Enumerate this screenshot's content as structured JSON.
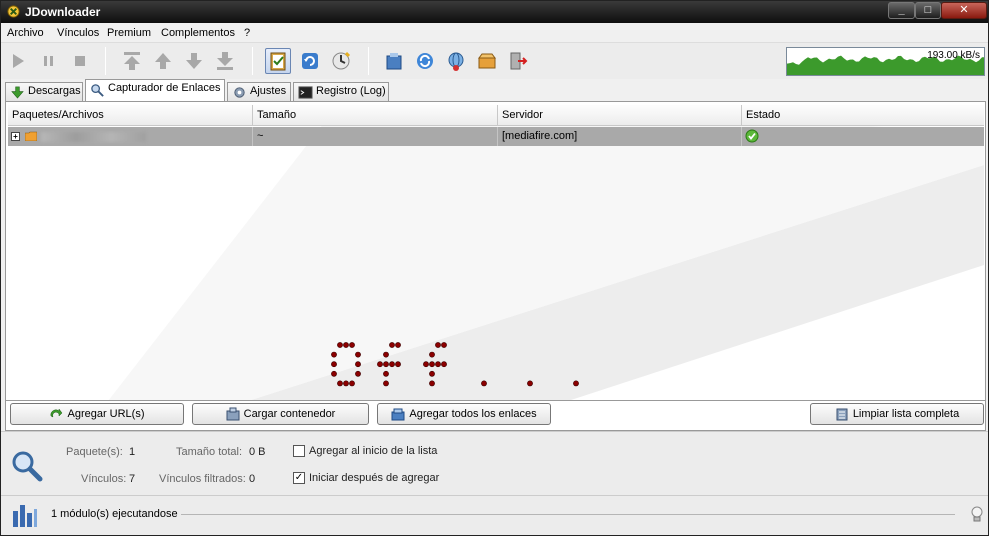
{
  "window": {
    "title": "JDownloader"
  },
  "window_controls": {
    "minimize": "_",
    "maximize": "□",
    "close": "✕"
  },
  "menu": [
    "Archivo",
    "Vínculos",
    "Premium",
    "Complementos",
    "?"
  ],
  "toolbar_icons": [
    "play-icon",
    "pause-icon",
    "stop-icon",
    "move-top-icon",
    "move-up-icon",
    "move-down-icon",
    "move-bottom-icon",
    "clipboard-monitor-icon",
    "reconnect-icon",
    "update-icon",
    "open-container-icon",
    "refresh-icon",
    "premium-icon",
    "package-icon",
    "exit-icon"
  ],
  "speed": "193.00 kB/s",
  "tabs": [
    {
      "label": "Descargas",
      "icon": "download-icon"
    },
    {
      "label": "Capturador de Enlaces",
      "icon": "linkgrabber-icon"
    },
    {
      "label": "Ajustes",
      "icon": "settings-icon"
    },
    {
      "label": "Registro (Log)",
      "icon": "log-icon"
    }
  ],
  "table": {
    "headers": [
      "Paquetes/Archivos",
      "Tamaño",
      "Servidor",
      "Estado"
    ],
    "rows": [
      {
        "expander": "+",
        "name": "",
        "size": "~",
        "host": "[mediafire.com]",
        "status": "ok"
      }
    ]
  },
  "watermark": "off...",
  "buttons": {
    "add_url": "Agregar URL(s)",
    "load_container": "Cargar contenedor",
    "add_all": "Agregar todos los enlaces",
    "clear_list": "Limpiar lista completa"
  },
  "info": {
    "packages_label": "Paquete(s):",
    "packages_value": "1",
    "total_size_label": "Tamaño total:",
    "total_size_value": "0 B",
    "links_label": "Vínculos:",
    "links_value": "7",
    "filtered_label": "Vínculos filtrados:",
    "filtered_value": "0",
    "add_top_label": "Agregar al inicio de la lista",
    "add_top_checked": false,
    "autostart_label": "Iniciar después de agregar",
    "autostart_checked": true
  },
  "status": {
    "text": "1 módulo(s) ejecutandose"
  },
  "colors": {
    "accent_green": "#3c9a2c",
    "row_selected": "#a9a9a9",
    "watermark": "#8b0000"
  }
}
